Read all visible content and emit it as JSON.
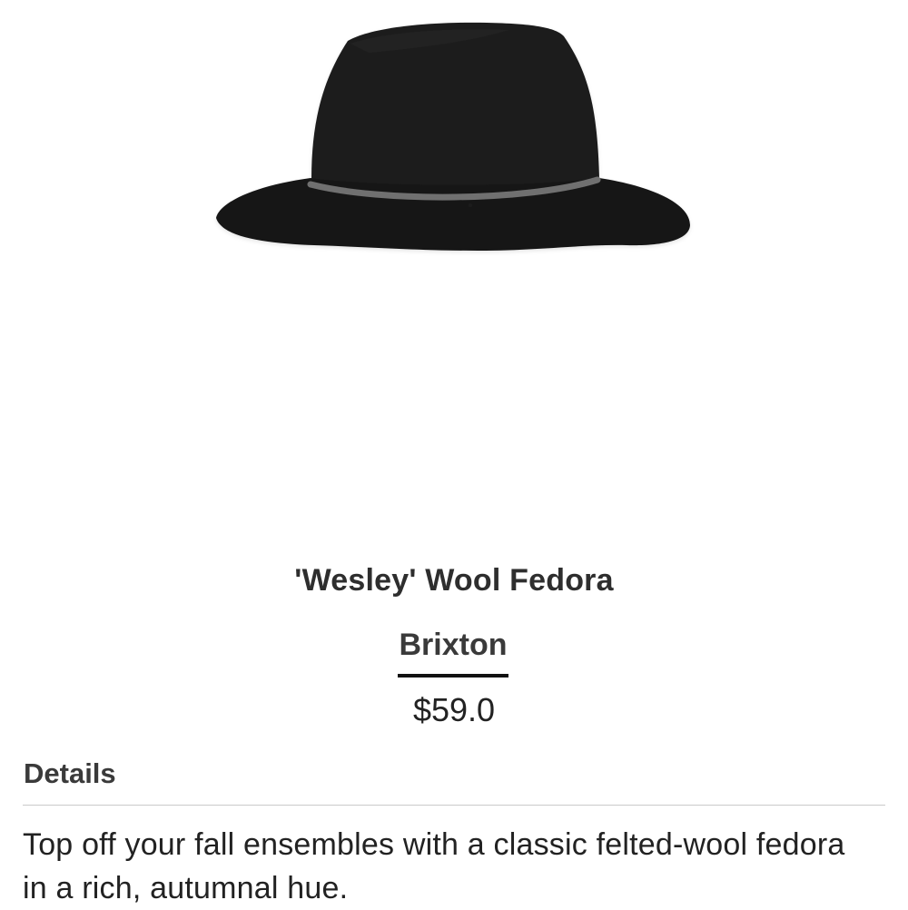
{
  "product": {
    "title": "'Wesley' Wool Fedora",
    "brand": "Brixton",
    "price": "$59.0"
  },
  "details": {
    "heading": "Details",
    "description": "Top off your fall ensembles with a classic felted-wool fedora in a rich, autumnal hue."
  },
  "image": {
    "icon": "fedora-hat-image",
    "hat_color": "#1f1f1f",
    "band_color": "#6f6f6f"
  }
}
